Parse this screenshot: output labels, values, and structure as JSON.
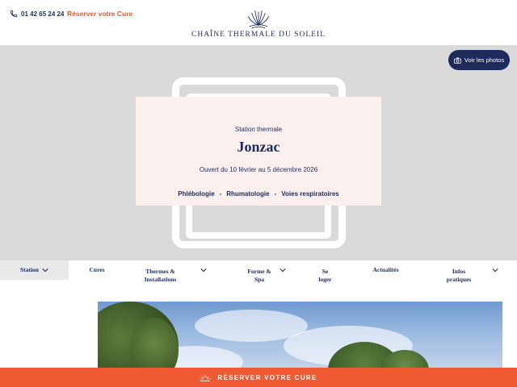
{
  "header": {
    "phone_number": "01 42 65 24 24",
    "reserve_link": "Réserver votre Cure",
    "logo_text": "CHAÎNE THERMALE DU SOLEIL"
  },
  "hero": {
    "photos_button": "Voir les photos",
    "kicker": "Station thermale",
    "title": "Jonzac",
    "dates": "Ouvert du 10 février au 5 décembre 2026",
    "specialties": [
      "Phlébologie",
      "Rhumatologie",
      "Voies respiratoires"
    ],
    "separator": "-"
  },
  "nav": {
    "items": [
      {
        "line1": "Station",
        "line2": "",
        "has_chevron": true,
        "active": true
      },
      {
        "line1": "Cures",
        "line2": "",
        "has_chevron": false,
        "active": false
      },
      {
        "line1": "Thermes &",
        "line2": "Installations",
        "has_chevron": true,
        "active": false
      },
      {
        "line1": "Forme &",
        "line2": "Spa",
        "has_chevron": true,
        "active": false
      },
      {
        "line1": "Se",
        "line2": "loger",
        "has_chevron": false,
        "active": false
      },
      {
        "line1": "Actualités",
        "line2": "",
        "has_chevron": false,
        "active": false
      },
      {
        "line1": "Infos",
        "line2": "pratiques",
        "has_chevron": true,
        "active": false
      }
    ]
  },
  "banner": {
    "label": "RÉSERVER VOTRE CURE"
  },
  "colors": {
    "navy": "#1f2a5c",
    "accent_orange": "#f05a32",
    "link_orange": "#e05a2b",
    "card_pink": "#fbf0ee",
    "hero_gray": "#d9d9d9"
  },
  "icons": [
    "phone-icon",
    "logo-mark-icon",
    "camera-icon",
    "chevron-down-icon",
    "sun-icon"
  ]
}
